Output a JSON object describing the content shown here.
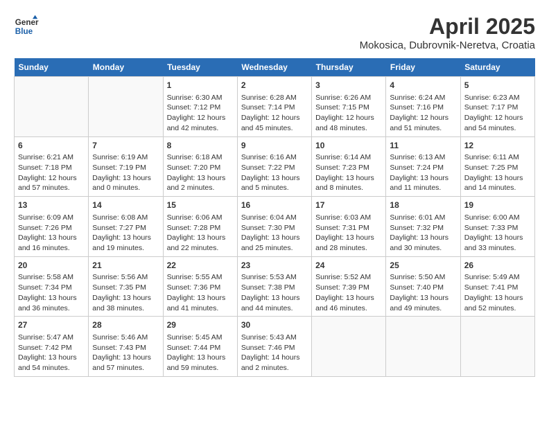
{
  "header": {
    "logo_line1": "General",
    "logo_line2": "Blue",
    "title": "April 2025",
    "subtitle": "Mokosica, Dubrovnik-Neretva, Croatia"
  },
  "days_of_week": [
    "Sunday",
    "Monday",
    "Tuesday",
    "Wednesday",
    "Thursday",
    "Friday",
    "Saturday"
  ],
  "weeks": [
    [
      {
        "day": "",
        "info": ""
      },
      {
        "day": "",
        "info": ""
      },
      {
        "day": "1",
        "info": "Sunrise: 6:30 AM\nSunset: 7:12 PM\nDaylight: 12 hours and 42 minutes."
      },
      {
        "day": "2",
        "info": "Sunrise: 6:28 AM\nSunset: 7:14 PM\nDaylight: 12 hours and 45 minutes."
      },
      {
        "day": "3",
        "info": "Sunrise: 6:26 AM\nSunset: 7:15 PM\nDaylight: 12 hours and 48 minutes."
      },
      {
        "day": "4",
        "info": "Sunrise: 6:24 AM\nSunset: 7:16 PM\nDaylight: 12 hours and 51 minutes."
      },
      {
        "day": "5",
        "info": "Sunrise: 6:23 AM\nSunset: 7:17 PM\nDaylight: 12 hours and 54 minutes."
      }
    ],
    [
      {
        "day": "6",
        "info": "Sunrise: 6:21 AM\nSunset: 7:18 PM\nDaylight: 12 hours and 57 minutes."
      },
      {
        "day": "7",
        "info": "Sunrise: 6:19 AM\nSunset: 7:19 PM\nDaylight: 13 hours and 0 minutes."
      },
      {
        "day": "8",
        "info": "Sunrise: 6:18 AM\nSunset: 7:20 PM\nDaylight: 13 hours and 2 minutes."
      },
      {
        "day": "9",
        "info": "Sunrise: 6:16 AM\nSunset: 7:22 PM\nDaylight: 13 hours and 5 minutes."
      },
      {
        "day": "10",
        "info": "Sunrise: 6:14 AM\nSunset: 7:23 PM\nDaylight: 13 hours and 8 minutes."
      },
      {
        "day": "11",
        "info": "Sunrise: 6:13 AM\nSunset: 7:24 PM\nDaylight: 13 hours and 11 minutes."
      },
      {
        "day": "12",
        "info": "Sunrise: 6:11 AM\nSunset: 7:25 PM\nDaylight: 13 hours and 14 minutes."
      }
    ],
    [
      {
        "day": "13",
        "info": "Sunrise: 6:09 AM\nSunset: 7:26 PM\nDaylight: 13 hours and 16 minutes."
      },
      {
        "day": "14",
        "info": "Sunrise: 6:08 AM\nSunset: 7:27 PM\nDaylight: 13 hours and 19 minutes."
      },
      {
        "day": "15",
        "info": "Sunrise: 6:06 AM\nSunset: 7:28 PM\nDaylight: 13 hours and 22 minutes."
      },
      {
        "day": "16",
        "info": "Sunrise: 6:04 AM\nSunset: 7:30 PM\nDaylight: 13 hours and 25 minutes."
      },
      {
        "day": "17",
        "info": "Sunrise: 6:03 AM\nSunset: 7:31 PM\nDaylight: 13 hours and 28 minutes."
      },
      {
        "day": "18",
        "info": "Sunrise: 6:01 AM\nSunset: 7:32 PM\nDaylight: 13 hours and 30 minutes."
      },
      {
        "day": "19",
        "info": "Sunrise: 6:00 AM\nSunset: 7:33 PM\nDaylight: 13 hours and 33 minutes."
      }
    ],
    [
      {
        "day": "20",
        "info": "Sunrise: 5:58 AM\nSunset: 7:34 PM\nDaylight: 13 hours and 36 minutes."
      },
      {
        "day": "21",
        "info": "Sunrise: 5:56 AM\nSunset: 7:35 PM\nDaylight: 13 hours and 38 minutes."
      },
      {
        "day": "22",
        "info": "Sunrise: 5:55 AM\nSunset: 7:36 PM\nDaylight: 13 hours and 41 minutes."
      },
      {
        "day": "23",
        "info": "Sunrise: 5:53 AM\nSunset: 7:38 PM\nDaylight: 13 hours and 44 minutes."
      },
      {
        "day": "24",
        "info": "Sunrise: 5:52 AM\nSunset: 7:39 PM\nDaylight: 13 hours and 46 minutes."
      },
      {
        "day": "25",
        "info": "Sunrise: 5:50 AM\nSunset: 7:40 PM\nDaylight: 13 hours and 49 minutes."
      },
      {
        "day": "26",
        "info": "Sunrise: 5:49 AM\nSunset: 7:41 PM\nDaylight: 13 hours and 52 minutes."
      }
    ],
    [
      {
        "day": "27",
        "info": "Sunrise: 5:47 AM\nSunset: 7:42 PM\nDaylight: 13 hours and 54 minutes."
      },
      {
        "day": "28",
        "info": "Sunrise: 5:46 AM\nSunset: 7:43 PM\nDaylight: 13 hours and 57 minutes."
      },
      {
        "day": "29",
        "info": "Sunrise: 5:45 AM\nSunset: 7:44 PM\nDaylight: 13 hours and 59 minutes."
      },
      {
        "day": "30",
        "info": "Sunrise: 5:43 AM\nSunset: 7:46 PM\nDaylight: 14 hours and 2 minutes."
      },
      {
        "day": "",
        "info": ""
      },
      {
        "day": "",
        "info": ""
      },
      {
        "day": "",
        "info": ""
      }
    ]
  ]
}
